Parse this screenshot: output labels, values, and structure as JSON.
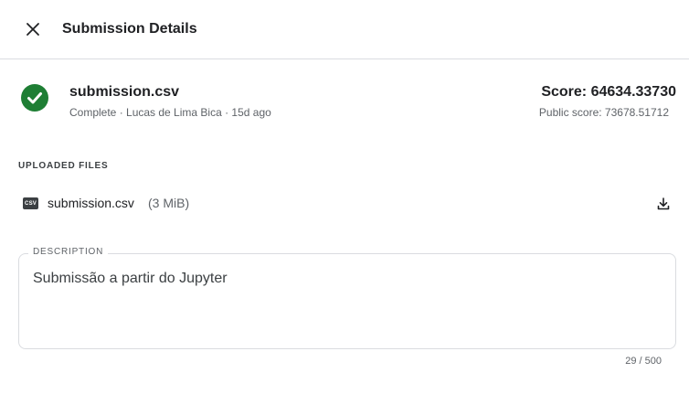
{
  "header": {
    "title": "Submission Details",
    "close_icon": "close-icon"
  },
  "submission": {
    "status_icon": "check-circle-icon",
    "status_color": "#1e7e34",
    "file_name": "submission.csv",
    "meta": "Complete · Lucas de Lima Bica · 15d ago",
    "score": "Score: 64634.33730",
    "public_score": "Public score: 73678.51712"
  },
  "uploaded_files": {
    "section_label": "UPLOADED FILES",
    "files": [
      {
        "icon": "csv-file-icon",
        "icon_text": "CSV",
        "name": "submission.csv",
        "size": "(3 MiB)",
        "download_icon": "download-icon"
      }
    ]
  },
  "description": {
    "label": "DESCRIPTION",
    "value": "Submissão a partir do Jupyter",
    "char_count": "29 / 500"
  }
}
